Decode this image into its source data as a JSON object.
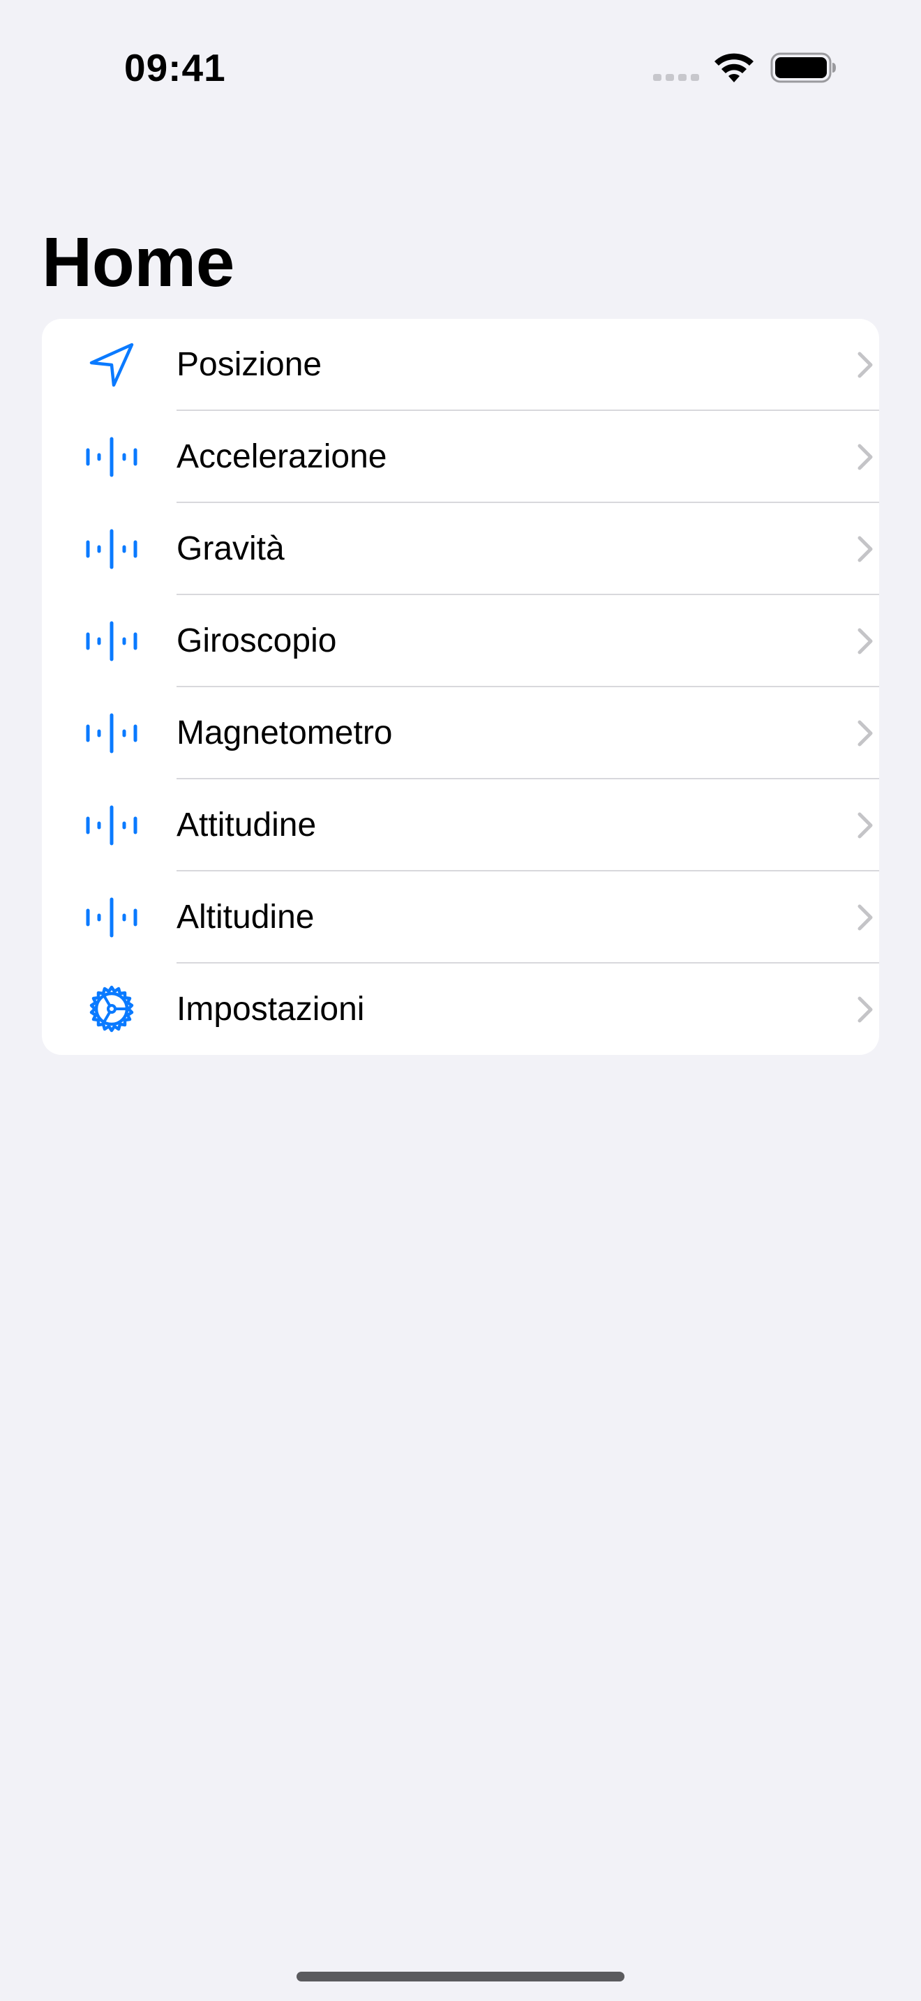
{
  "status_bar": {
    "time": "09:41"
  },
  "header": {
    "title": "Home"
  },
  "colors": {
    "background": "#F2F2F7",
    "accent": "#0A7AFF",
    "chevron": "#C4C4C7"
  },
  "menu": {
    "items": [
      {
        "label": "Posizione",
        "icon": "location-arrow-icon"
      },
      {
        "label": "Accelerazione",
        "icon": "waveform-icon"
      },
      {
        "label": "Gravità",
        "icon": "waveform-icon"
      },
      {
        "label": "Giroscopio",
        "icon": "waveform-icon"
      },
      {
        "label": "Magnetometro",
        "icon": "waveform-icon"
      },
      {
        "label": "Attitudine",
        "icon": "waveform-icon"
      },
      {
        "label": "Altitudine",
        "icon": "waveform-icon"
      },
      {
        "label": "Impostazioni",
        "icon": "gear-icon"
      }
    ]
  }
}
